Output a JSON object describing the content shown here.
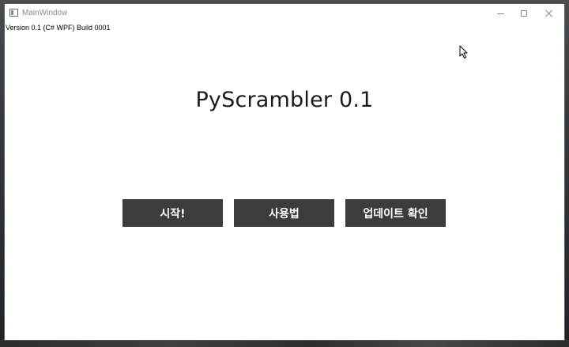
{
  "window": {
    "title": "MainWindow",
    "controls": {
      "minimize": "minimize-icon",
      "maximize": "maximize-icon",
      "close": "close-icon"
    }
  },
  "version_label": "Version 0.1 (C# WPF) Build 0001",
  "app_title": "PyScrambler 0.1",
  "buttons": {
    "start": "시작!",
    "usage": "사용법",
    "update": "업데이트 확인"
  },
  "colors": {
    "button_bg": "#3c3c3c",
    "button_text": "#ffffff",
    "window_bg": "#ffffff"
  }
}
